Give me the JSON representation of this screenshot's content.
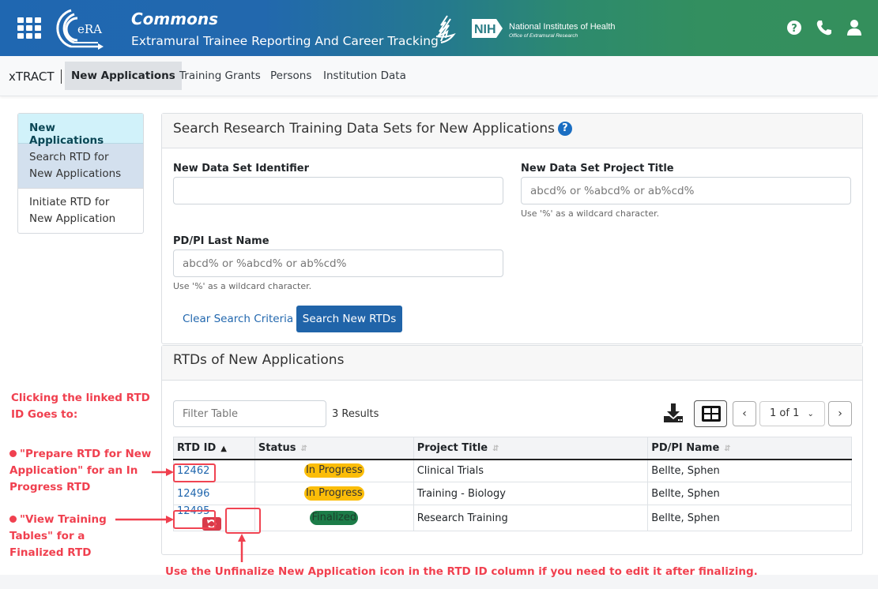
{
  "header": {
    "app_name": "Commons",
    "app_subtitle": "Extramural Trainee Reporting And Career Tracking",
    "era_logo_text": "eRA",
    "nih_badge": "NIH",
    "nih_name": "National Institutes of Health",
    "nih_office": "Office of Extramural Research",
    "icons": [
      "apps-grid-icon",
      "help-icon",
      "phone-icon",
      "user-icon"
    ],
    "colors": {
      "gradient_start": "#1f67b1",
      "gradient_end": "#348f5c"
    }
  },
  "nav": {
    "brand": "xTRACT",
    "items": [
      {
        "label": "New Applications",
        "active": true
      },
      {
        "label": "Training Grants",
        "active": false
      },
      {
        "label": "Persons",
        "active": false
      },
      {
        "label": "Institution Data",
        "active": false
      }
    ]
  },
  "sidebar": {
    "heading": "New Applications",
    "items": [
      {
        "label": "Search RTD for New Applications",
        "active": true
      },
      {
        "label": "Initiate RTD for New Application",
        "active": false
      }
    ]
  },
  "search": {
    "title": "Search Research Training Data Sets for New Applications",
    "fields": {
      "identifier": {
        "label": "New Data Set Identifier",
        "value": "",
        "placeholder": ""
      },
      "project_title": {
        "label": "New Data Set Project Title",
        "value": "",
        "placeholder": "abcd% or %abcd% or ab%cd%",
        "help": "Use '%' as a wildcard character."
      },
      "pi_last_name": {
        "label": "PD/PI Last Name",
        "value": "",
        "placeholder": "abcd% or %abcd% or ab%cd%",
        "help": "Use '%' as a wildcard character."
      }
    },
    "clear_label": "Clear Search Criteria",
    "submit_label": "Search New RTDs"
  },
  "results": {
    "title": "RTDs of New Applications",
    "filter_placeholder": "Filter Table",
    "count_text": "3 Results",
    "pagination": {
      "current": "1 of 1",
      "prev": "‹",
      "next": "›"
    },
    "columns": [
      {
        "label": "RTD ID",
        "sort": "asc"
      },
      {
        "label": "Status",
        "sort": "none"
      },
      {
        "label": "Project Title",
        "sort": "none"
      },
      {
        "label": "PD/PI Name",
        "sort": "none"
      }
    ],
    "rows": [
      {
        "rtd_id": "12462",
        "status": "In Progress",
        "project_title": "Clinical Trials",
        "pi_name": "Bellte, Sphen",
        "unfinalize": false
      },
      {
        "rtd_id": "12496",
        "status": "In Progress",
        "project_title": "Training - Biology",
        "pi_name": "Bellte, Sphen",
        "unfinalize": false
      },
      {
        "rtd_id": "12495",
        "status": "Finalized",
        "project_title": "Research Training",
        "pi_name": "Bellte, Sphen",
        "unfinalize": true
      }
    ],
    "status_colors": {
      "In Progress": "#fbbd08",
      "Finalized": "#1c7c48"
    }
  },
  "annotations": {
    "intro": "Clicking the linked RTD ID Goes to:",
    "bullet1": "\"Prepare RTD for New Application\" for an In Progress RTD",
    "bullet2": "\"View Training Tables\" for a Finalized RTD",
    "bottom": "Use the Unfinalize New Application icon in the RTD ID column if you need to edit it after finalizing.",
    "color": "#f0404f"
  }
}
